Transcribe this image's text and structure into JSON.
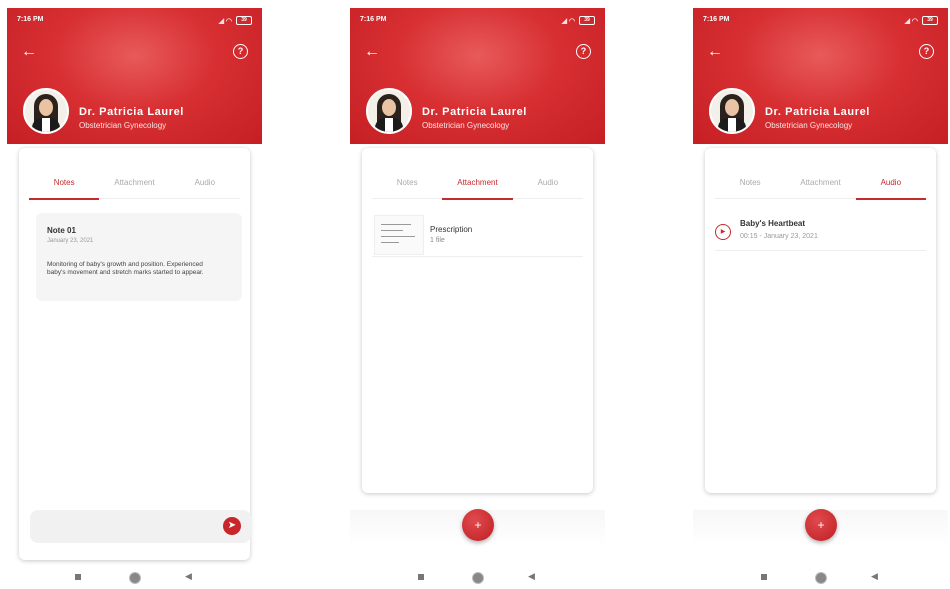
{
  "status": {
    "time": "7:16 PM",
    "battery": "39"
  },
  "doctor": {
    "name": "Dr. Patricia Laurel",
    "specialty": "Obstetrician Gynecology"
  },
  "help_glyph": "?",
  "tabs": {
    "notes": "Notes",
    "attachment": "Attachment",
    "audio": "Audio"
  },
  "screens": [
    {
      "active_tab": "notes",
      "note": {
        "title": "Note 01",
        "date": "January 23, 2021",
        "body": "Monitoring of baby's growth and position. Experienced baby's movement and stretch marks started to appear."
      }
    },
    {
      "active_tab": "attachment",
      "attachment": {
        "title": "Prescription",
        "subtitle": "1 file"
      }
    },
    {
      "active_tab": "audio",
      "audio": {
        "title": "Baby's Heartbeat",
        "subtitle": "00:15 - January 23, 2021"
      }
    }
  ],
  "fab_label": "+",
  "icons": [
    "back-arrow-icon",
    "help-icon",
    "send-icon",
    "play-icon",
    "add-icon",
    "nav-home-icon",
    "nav-back-icon",
    "nav-recents-icon"
  ],
  "colors": {
    "brand_red": "#c62a2d"
  }
}
